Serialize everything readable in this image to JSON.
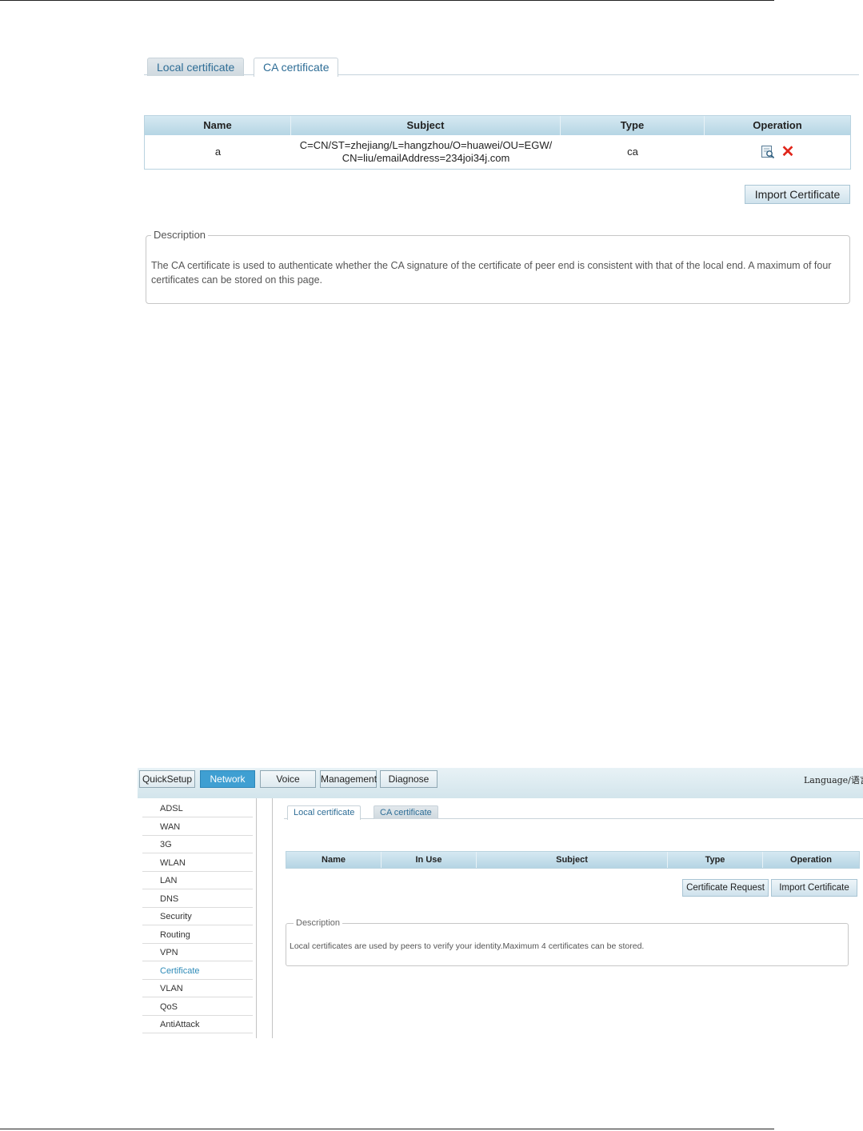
{
  "screen1": {
    "tabs": [
      {
        "label": "Local certificate",
        "active": false
      },
      {
        "label": "CA certificate",
        "active": true
      }
    ],
    "table": {
      "columns": [
        "Name",
        "Subject",
        "Type",
        "Operation"
      ],
      "rows": [
        {
          "name": "a",
          "subject_line1": "C=CN/ST=zhejiang/L=hangzhou/O=huawei/OU=EGW/",
          "subject_line2": "CN=liu/emailAddress=234joi34j.com",
          "type": "ca",
          "operations": [
            "view-icon",
            "delete-icon"
          ]
        }
      ]
    },
    "import_button": "Import Certificate",
    "description": {
      "legend": "Description",
      "text": "The CA certificate is used to authenticate whether the CA signature of the certificate of peer end is consistent with that of the local end. A maximum of four certificates can be stored on this page."
    }
  },
  "screen2": {
    "nav": [
      {
        "label": "QuickSetup",
        "active": false
      },
      {
        "label": "Network",
        "active": true
      },
      {
        "label": "Voice",
        "active": false
      },
      {
        "label": "Management",
        "active": false
      },
      {
        "label": "Diagnose",
        "active": false
      }
    ],
    "language_label": "Language/语言:",
    "sidebar": [
      "ADSL",
      "WAN",
      "3G",
      "WLAN",
      "LAN",
      "DNS",
      "Security",
      "Routing",
      "VPN",
      "Certificate",
      "VLAN",
      "QoS",
      "AntiAttack"
    ],
    "sidebar_active": "Certificate",
    "tabs": [
      {
        "label": "Local certificate",
        "active": true
      },
      {
        "label": "CA certificate",
        "active": false
      }
    ],
    "table": {
      "columns": [
        "Name",
        "In Use",
        "Subject",
        "Type",
        "Operation"
      ]
    },
    "buttons": {
      "certificate_request": "Certificate Request",
      "import_certificate": "Import Certificate"
    },
    "description": {
      "legend": "Description",
      "text": "Local certificates are used by peers to verify your identity.Maximum 4 certificates can be stored."
    }
  },
  "colors": {
    "tab_text": "#2e6d96",
    "table_header": "#b5d5e4",
    "nav_active": "#3f9fd2",
    "delete_icon": "#e0261b",
    "sidebar_active": "#2e8bb8"
  }
}
